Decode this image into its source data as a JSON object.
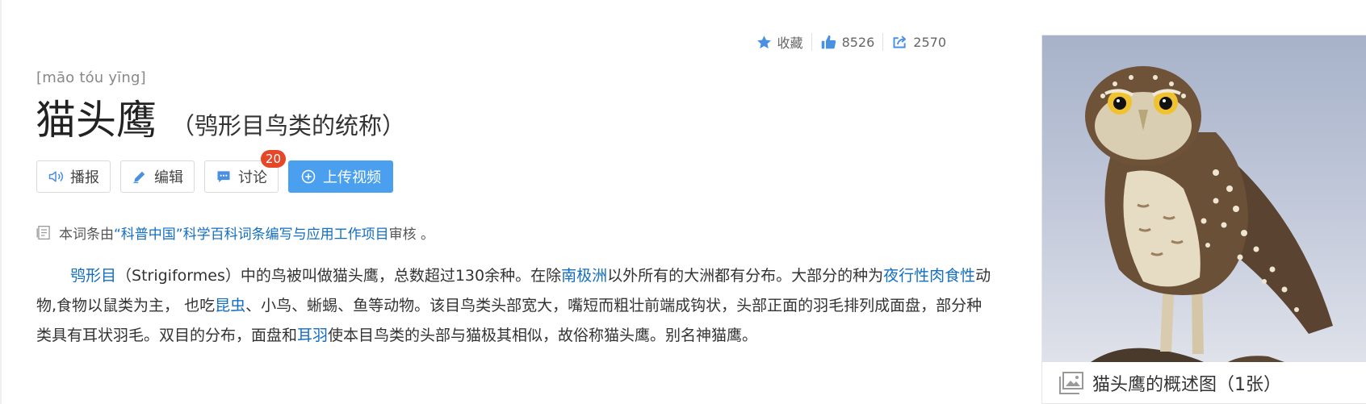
{
  "actions": {
    "favorite_label": "收藏",
    "like_count": "8526",
    "share_count": "2570"
  },
  "entry": {
    "pinyin": "[māo tóu yīng]",
    "title": "猫头鹰",
    "subtitle": "（鸮形目鸟类的统称）"
  },
  "buttons": {
    "broadcast": "播报",
    "edit": "编辑",
    "discuss": "讨论",
    "discuss_badge": "20",
    "upload_video": "上传视频"
  },
  "review": {
    "prefix": "本词条由",
    "org_link": "“科普中国”科学百科词条编写与应用工作项目",
    "suffix": " 审核 。"
  },
  "summary": {
    "link_strigiformes": "鸮形目",
    "t1": "（Strigiformes）中的鸟被叫做猫头鹰，总数超过130余种。在除",
    "link_antarctica": "南极洲",
    "t2": "以外所有的大洲都有分布。大部分的种为",
    "link_nocturnal": "夜行性肉食性",
    "t3": "动物,食物以鼠类为主， 也吃",
    "link_insects": "昆虫",
    "t4": "、小鸟、蜥蜴、鱼等动物。该目鸟类头部宽大，嘴短而粗壮前端成钩状，头部正面的羽毛排列成面盘，部分种类具有耳状羽毛。双目的分布，面盘和",
    "link_ear_tufts": "耳羽",
    "t5": "使本目鸟类的头部与猫极其相似，故俗称猫头鹰。别名神猫鹰。"
  },
  "album": {
    "caption": "猫头鹰的概述图（1张）"
  },
  "colors": {
    "link": "#136ec2",
    "primary_button": "#4aa0ee",
    "badge": "#e64727",
    "icon_blue": "#4a90e2"
  }
}
